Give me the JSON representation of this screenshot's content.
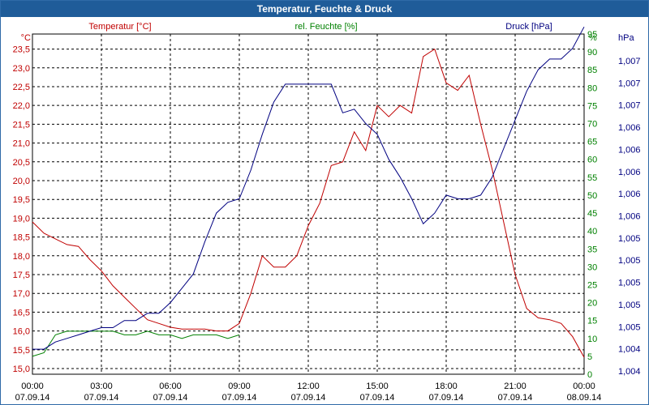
{
  "window": {
    "title": "Temperatur, Feuchte & Druck"
  },
  "colors": {
    "temperature": "#c00000",
    "humidity": "#008000",
    "pressure": "#000080",
    "title_bar": "#1f5c99"
  },
  "chart_data": {
    "type": "line",
    "title": "Temperatur, Feuchte & Druck",
    "grid": true,
    "x_ticks": [
      {
        "time": "00:00",
        "date": "07.09.14"
      },
      {
        "time": "03:00",
        "date": "07.09.14"
      },
      {
        "time": "06:00",
        "date": "07.09.14"
      },
      {
        "time": "09:00",
        "date": "07.09.14"
      },
      {
        "time": "12:00",
        "date": "07.09.14"
      },
      {
        "time": "15:00",
        "date": "07.09.14"
      },
      {
        "time": "18:00",
        "date": "07.09.14"
      },
      {
        "time": "21:00",
        "date": "07.09.14"
      },
      {
        "time": "00:00",
        "date": "08.09.14"
      }
    ],
    "xlim": [
      "07.09.14 00:00",
      "08.09.14 00:00"
    ],
    "axes": {
      "temperature": {
        "label": "Temperatur [°C]",
        "unit": "°C",
        "ylim": [
          14.85,
          23.9
        ],
        "ticks": [
          "15,0",
          "15,5",
          "16,0",
          "16,5",
          "17,0",
          "17,5",
          "18,0",
          "18,5",
          "19,0",
          "19,5",
          "20,0",
          "20,5",
          "21,0",
          "21,5",
          "22,0",
          "22,5",
          "23,0",
          "23,5"
        ]
      },
      "humidity": {
        "label": "rel. Feuchte [%]",
        "unit": "%",
        "ylim": [
          0,
          95
        ],
        "ticks": [
          "0",
          "5",
          "10",
          "15",
          "20",
          "25",
          "30",
          "35",
          "40",
          "45",
          "50",
          "55",
          "60",
          "65",
          "70",
          "75",
          "80",
          "85",
          "90",
          "95"
        ]
      },
      "pressure": {
        "label": "Druck [hPa]",
        "unit": "hPa",
        "ticks": [
          "1,004",
          "1,004",
          "1,005",
          "1,005",
          "1,005",
          "1,005",
          "1,005",
          "1,006",
          "1,006",
          "1,006",
          "1,006",
          "1,006",
          "1,007",
          "1,007",
          "1,007"
        ]
      }
    },
    "series": [
      {
        "name": "Temperatur [°C]",
        "axis": "temperature",
        "x": [
          "07.09.14 00:00",
          "07.09.14 00:30",
          "07.09.14 01:00",
          "07.09.14 01:30",
          "07.09.14 02:00",
          "07.09.14 02:30",
          "07.09.14 03:00",
          "07.09.14 03:30",
          "07.09.14 04:00",
          "07.09.14 04:30",
          "07.09.14 05:00",
          "07.09.14 05:30",
          "07.09.14 06:00",
          "07.09.14 06:30",
          "07.09.14 07:00",
          "07.09.14 07:30",
          "07.09.14 08:00",
          "07.09.14 08:30",
          "07.09.14 09:00",
          "07.09.14 09:30",
          "07.09.14 10:00",
          "07.09.14 10:30",
          "07.09.14 11:00",
          "07.09.14 11:30",
          "07.09.14 12:00",
          "07.09.14 12:30",
          "07.09.14 13:00",
          "07.09.14 13:30",
          "07.09.14 14:00",
          "07.09.14 14:30",
          "07.09.14 15:00",
          "07.09.14 15:30",
          "07.09.14 16:00",
          "07.09.14 16:30",
          "07.09.14 17:00",
          "07.09.14 17:30",
          "07.09.14 18:00",
          "07.09.14 18:30",
          "07.09.14 19:00",
          "07.09.14 19:30",
          "07.09.14 20:00",
          "07.09.14 20:30",
          "07.09.14 21:00",
          "07.09.14 21:30",
          "07.09.14 22:00",
          "07.09.14 22:30",
          "07.09.14 23:00",
          "07.09.14 23:30",
          "08.09.14 00:00"
        ],
        "y": [
          18.9,
          18.6,
          18.45,
          18.3,
          18.25,
          17.9,
          17.6,
          17.2,
          16.9,
          16.6,
          16.3,
          16.2,
          16.1,
          16.05,
          16.05,
          16.05,
          16.0,
          16.0,
          16.2,
          17.0,
          18.0,
          17.7,
          17.7,
          18.0,
          18.8,
          19.4,
          20.4,
          20.5,
          21.3,
          20.8,
          22.0,
          21.7,
          22.0,
          21.8,
          23.3,
          23.5,
          22.6,
          22.4,
          22.8,
          21.5,
          20.3,
          18.9,
          17.5,
          16.6,
          16.35,
          16.3,
          16.2,
          15.85,
          15.3
        ]
      },
      {
        "name": "rel. Feuchte [%]",
        "axis": "humidity",
        "x": [
          "07.09.14 00:00",
          "07.09.14 00:30",
          "07.09.14 01:00",
          "07.09.14 01:30",
          "07.09.14 02:00",
          "07.09.14 02:30",
          "07.09.14 03:00",
          "07.09.14 03:30",
          "07.09.14 04:00",
          "07.09.14 04:30",
          "07.09.14 05:00",
          "07.09.14 05:30",
          "07.09.14 06:00",
          "07.09.14 06:30",
          "07.09.14 07:00",
          "07.09.14 07:30",
          "07.09.14 08:00",
          "07.09.14 08:30",
          "07.09.14 09:00"
        ],
        "y": [
          5,
          6,
          11,
          12,
          12,
          12,
          12,
          12,
          11,
          11,
          12,
          11,
          11,
          10,
          11,
          11,
          11,
          10,
          11
        ]
      },
      {
        "name": "Druck [hPa]",
        "axis": "pressure",
        "x": [
          "07.09.14 00:00",
          "07.09.14 00:30",
          "07.09.14 01:00",
          "07.09.14 01:30",
          "07.09.14 02:00",
          "07.09.14 02:30",
          "07.09.14 03:00",
          "07.09.14 03:30",
          "07.09.14 04:00",
          "07.09.14 04:30",
          "07.09.14 05:00",
          "07.09.14 05:30",
          "07.09.14 06:00",
          "07.09.14 06:30",
          "07.09.14 07:00",
          "07.09.14 07:30",
          "07.09.14 08:00",
          "07.09.14 08:30",
          "07.09.14 09:00",
          "07.09.14 09:30",
          "07.09.14 10:00",
          "07.09.14 10:30",
          "07.09.14 11:00",
          "07.09.14 11:30",
          "07.09.14 12:00",
          "07.09.14 12:30",
          "07.09.14 13:00",
          "07.09.14 13:30",
          "07.09.14 14:00",
          "07.09.14 14:30",
          "07.09.14 15:00",
          "07.09.14 15:30",
          "07.09.14 16:00",
          "07.09.14 16:30",
          "07.09.14 17:00",
          "07.09.14 17:30",
          "07.09.14 18:00",
          "07.09.14 18:30",
          "07.09.14 19:00",
          "07.09.14 19:30",
          "07.09.14 20:00",
          "07.09.14 20:30",
          "07.09.14 21:00",
          "07.09.14 21:30",
          "07.09.14 22:00",
          "07.09.14 22:30",
          "07.09.14 23:00",
          "07.09.14 23:30",
          "08.09.14 00:00"
        ],
        "y": [
          7,
          7,
          9,
          10,
          11,
          12,
          13,
          13,
          15,
          15,
          17,
          17,
          20,
          24,
          28,
          37,
          45,
          48,
          49,
          57,
          67,
          76,
          81,
          81,
          81,
          81,
          81,
          73,
          74,
          70,
          67,
          60,
          55,
          49,
          42,
          45,
          50,
          49,
          49,
          50,
          55,
          63,
          71,
          79,
          85,
          88,
          88,
          91,
          97
        ]
      }
    ]
  }
}
